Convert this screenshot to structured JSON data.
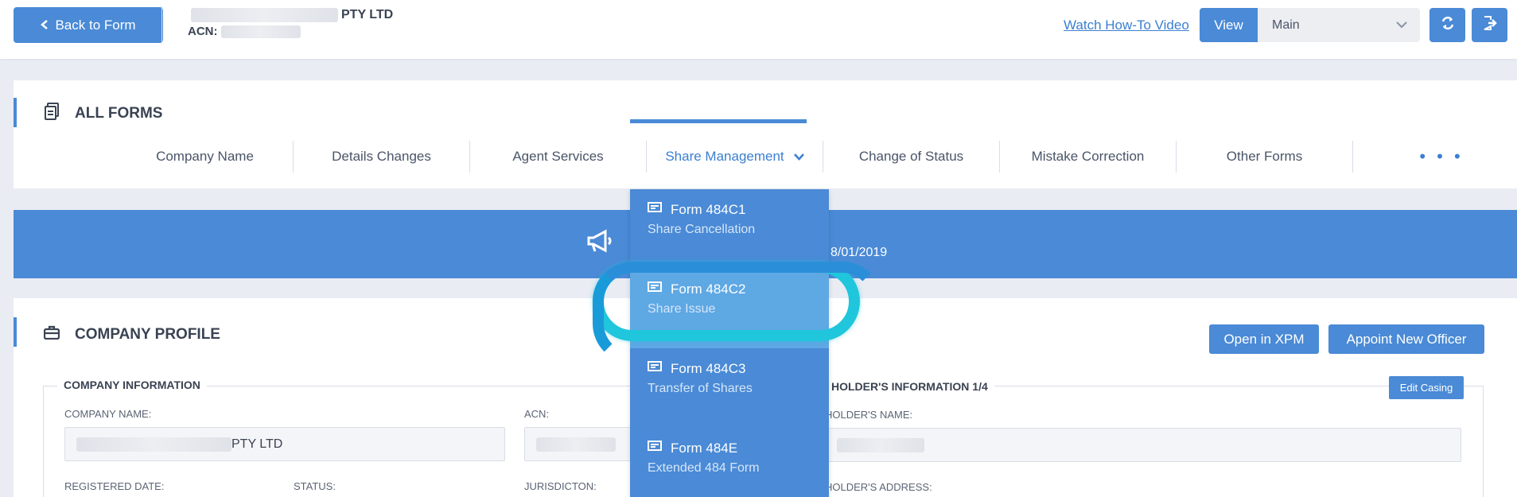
{
  "header": {
    "back_label": "Back to Form",
    "company_name_suffix": "PTY LTD",
    "acn_label": "ACN:",
    "watch_link": "Watch How-To Video",
    "view_label": "View",
    "view_selected": "Main"
  },
  "forms": {
    "title": "ALL FORMS",
    "tabs": [
      "Company Name",
      "Details Changes",
      "Agent Services",
      "Share Management",
      "Change of Status",
      "Mistake Correction",
      "Other Forms",
      "• • •"
    ]
  },
  "banner": {
    "date": "8/01/2019"
  },
  "dropdown": {
    "items": [
      {
        "code": "Form 484C1",
        "desc": "Share Cancellation"
      },
      {
        "code": "Form 484C2",
        "desc": "Share Issue"
      },
      {
        "code": "Form 484C3",
        "desc": "Transfer of Shares"
      },
      {
        "code": "Form 484E",
        "desc": "Extended 484 Form"
      }
    ]
  },
  "profile": {
    "title": "COMPANY PROFILE",
    "open_xpm": "Open in XPM",
    "appoint": "Appoint New Officer",
    "company_info_legend": "COMPANY INFORMATION",
    "company_name_label": "COMPANY NAME:",
    "company_name_value_suffix": "PTY LTD",
    "acn_label": "ACN:",
    "registered_date_label": "REGISTERED DATE:",
    "status_label": "STATUS:",
    "jurisdiction_label": "JURISDICTON:",
    "holder_legend": "HOLDER'S INFORMATION 1/4",
    "edit_casing": "Edit Casing",
    "holder_name_label": "HOLDER'S NAME:",
    "holder_address_label": "HOLDER'S ADDRESS:"
  },
  "colors": {
    "accent": "#4a8ad6",
    "highlight_ring": "#1fc6dc"
  }
}
